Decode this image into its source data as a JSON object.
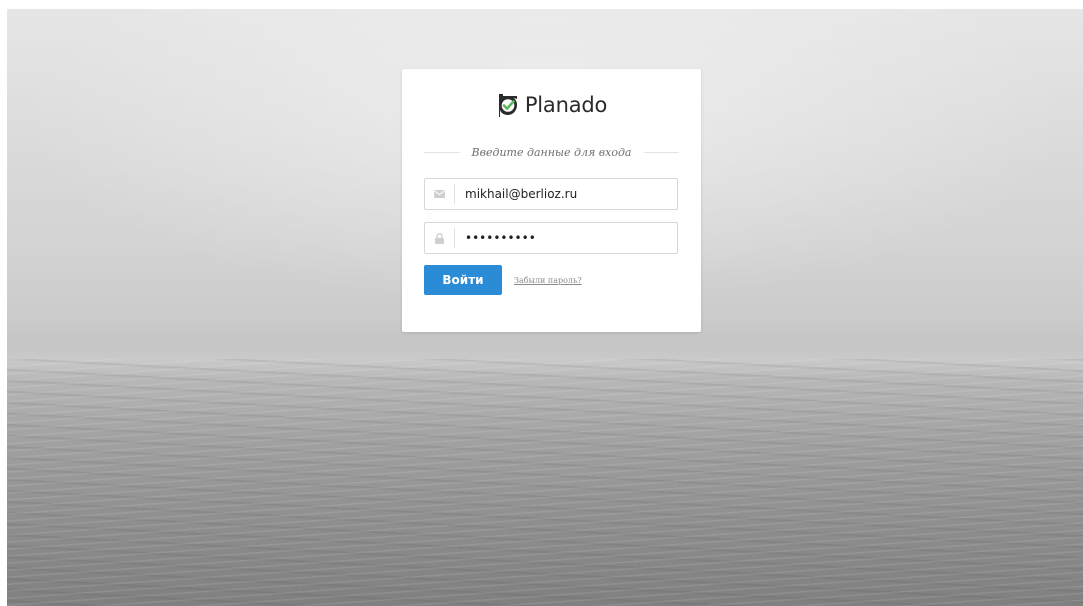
{
  "brand": {
    "name": "Planado",
    "logo_icon": "check-circle-icon",
    "logo_colors": {
      "mark": "#2b2b2b",
      "check": "#5cb85c"
    }
  },
  "login_form": {
    "caption": "Введите данные для входа",
    "email": {
      "value": "mikhail@berlioz.ru",
      "icon": "envelope-icon"
    },
    "password": {
      "value": "••••••••••",
      "icon": "lock-icon"
    },
    "submit_label": "Войти",
    "forgot_password_label": "Забыли пароль?"
  },
  "colors": {
    "accent": "#2a8bd6",
    "card_background": "#ffffff",
    "background": "#c8c8c8"
  }
}
